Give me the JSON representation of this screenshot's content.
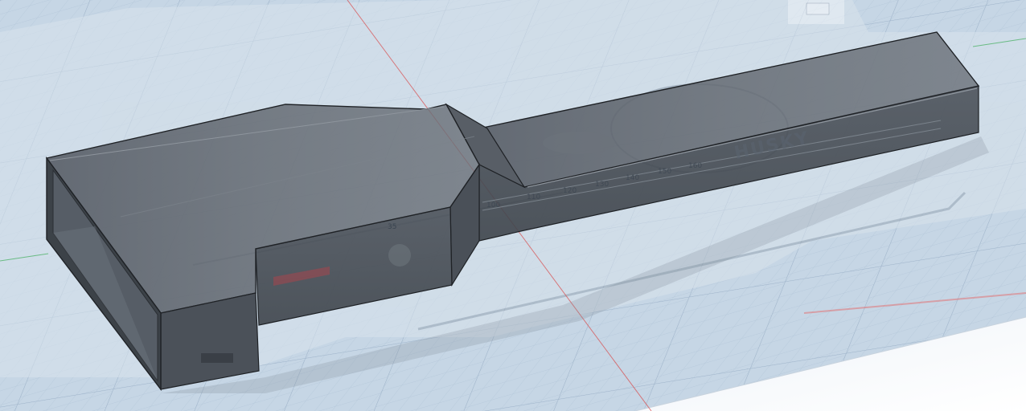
{
  "viewport": {
    "background": "#c9d8e6",
    "grid_color": "#a9bdd1",
    "x_axis_color": "#d94a4a",
    "y_axis_color": "#3fae5a"
  },
  "model": {
    "body_color": "#5f6670",
    "edge_color": "#1f2226"
  },
  "canvas_reference": {
    "brand": "HUSKY",
    "ruler_labels": [
      "35",
      "100",
      "110",
      "120",
      "130",
      "140",
      "150",
      "160"
    ]
  }
}
